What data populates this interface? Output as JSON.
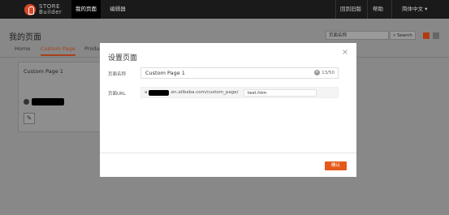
{
  "header": {
    "logo_line1": "STORE",
    "logo_line2": "Builder",
    "nav": [
      "我的页面",
      "编辑器"
    ],
    "right_links": [
      "回到旧版",
      "帮助",
      "简体中文 ▾"
    ]
  },
  "page": {
    "title": "我的页面",
    "search_placeholder": "页面名称",
    "search_button": "Search",
    "tabs": [
      "Home",
      "Custom Page",
      "Produc"
    ],
    "active_tab": "Custom Page"
  },
  "card": {
    "title": "Custom Page 1"
  },
  "modal": {
    "title": "设置页面",
    "name_label": "页面名称",
    "name_value": "Custom Page 1",
    "name_counter": "13/50",
    "url_label": "页面URL",
    "url_prefix_start": "a",
    "url_prefix_rest": ".en.alibaba.com/custom_page/",
    "url_value": "test.htm",
    "confirm": "确认"
  },
  "colors": {
    "accent": "#e55a1a",
    "topbar": "#1a1a1a",
    "overlay": "#888888"
  }
}
